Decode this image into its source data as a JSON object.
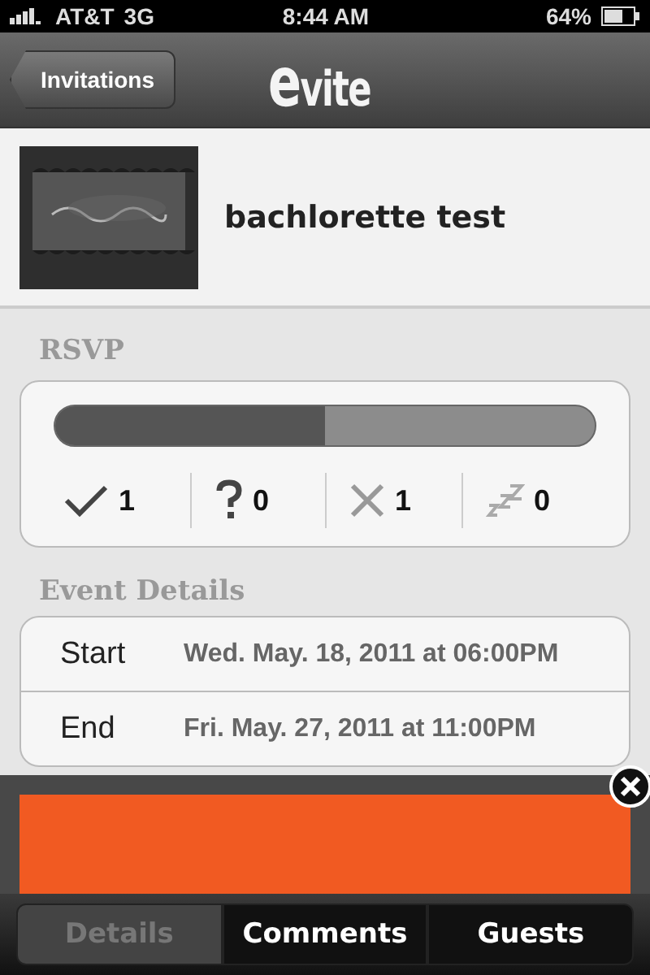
{
  "status_bar": {
    "carrier": "AT&T",
    "network": "3G",
    "time": "8:44 AM",
    "battery": "64%"
  },
  "nav_bar": {
    "back_button": "Invitations",
    "logo": "evite"
  },
  "event": {
    "title": "bachlorette test"
  },
  "rsvp": {
    "heading": "RSVP",
    "level": 0.5,
    "counts": [
      {
        "kind": "yes",
        "count": "1"
      },
      {
        "kind": "maybe",
        "count": "0"
      },
      {
        "kind": "no",
        "count": "1"
      },
      {
        "kind": "no_reply",
        "count": "0"
      }
    ]
  },
  "event_details": {
    "heading": "Event Details",
    "rows": [
      {
        "label": "Start",
        "value": "Wed. May. 18, 2011 at 06:00PM"
      },
      {
        "label": "End",
        "value": "Fri. May. 27, 2011 at 11:00PM"
      }
    ]
  },
  "tabs": [
    {
      "label": "Details",
      "selected": true
    },
    {
      "label": "Comments",
      "selected": false
    },
    {
      "label": "Guests",
      "selected": false
    }
  ]
}
